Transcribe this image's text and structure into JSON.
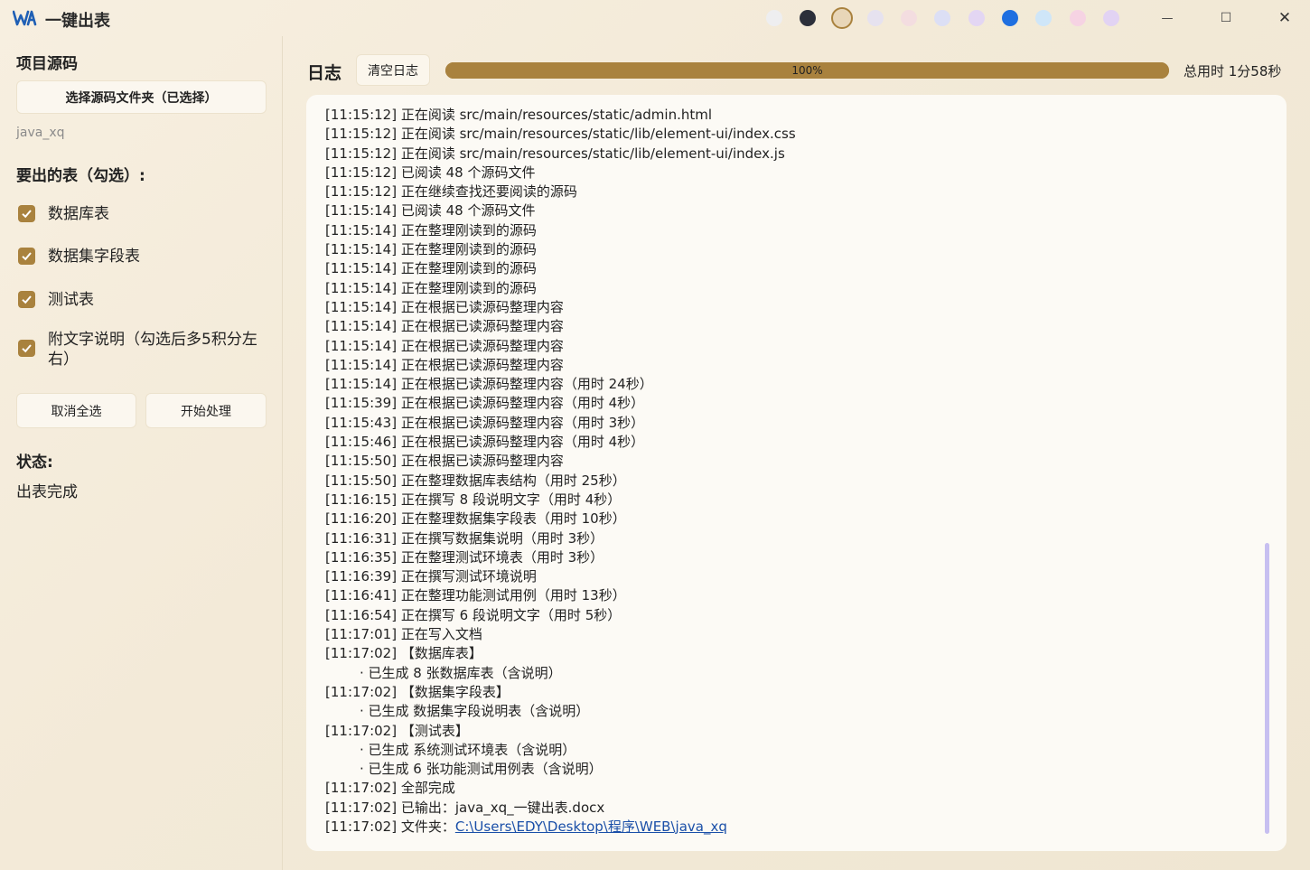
{
  "app": {
    "title": "一键出表",
    "window_controls": {
      "minimize": "—",
      "maximize": "☐",
      "close": "✕"
    }
  },
  "theme": {
    "accent": "#a9823e",
    "swatches": [
      {
        "name": "white",
        "color": "#eeeef0",
        "active": false
      },
      {
        "name": "dark",
        "color": "#2b2f3a",
        "active": false
      },
      {
        "name": "beige",
        "color": "#e8d6b8",
        "active": true
      },
      {
        "name": "lavender-grey",
        "color": "#e6e2ef",
        "active": false
      },
      {
        "name": "light-pink",
        "color": "#f3dde0",
        "active": false
      },
      {
        "name": "periwinkle",
        "color": "#dcdff5",
        "active": false
      },
      {
        "name": "lilac",
        "color": "#e3d6f3",
        "active": false
      },
      {
        "name": "blue",
        "color": "#1f6fe0",
        "active": false
      },
      {
        "name": "sky",
        "color": "#cfe6f8",
        "active": false
      },
      {
        "name": "pink",
        "color": "#f6d3e3",
        "active": false
      },
      {
        "name": "violet",
        "color": "#e2d3f3",
        "active": false
      }
    ]
  },
  "sidebar": {
    "source_title": "项目源码",
    "select_folder_label": "选择源码文件夹（已选择）",
    "folder_name": "java_xq",
    "tables_title": "要出的表（勾选）:",
    "options": [
      {
        "label": "数据库表",
        "checked": true
      },
      {
        "label": "数据集字段表",
        "checked": true
      },
      {
        "label": "测试表",
        "checked": true
      },
      {
        "label": "附文字说明（勾选后多5积分左右）",
        "checked": true
      }
    ],
    "deselect_all_label": "取消全选",
    "start_label": "开始处理",
    "status_title": "状态:",
    "status_value": "出表完成"
  },
  "main": {
    "log_title": "日志",
    "clear_log_label": "清空日志",
    "progress": {
      "value": 100,
      "label": "100%"
    },
    "total_time": "总用时 1分58秒",
    "log_lines": [
      {
        "text": "[11:15:12] 正在阅读 src/main/resources/static/admin.html"
      },
      {
        "text": "[11:15:12] 正在阅读 src/main/resources/static/lib/element-ui/index.css"
      },
      {
        "text": "[11:15:12] 正在阅读 src/main/resources/static/lib/element-ui/index.js"
      },
      {
        "text": "[11:15:12] 已阅读 48 个源码文件"
      },
      {
        "text": "[11:15:12] 正在继续查找还要阅读的源码"
      },
      {
        "text": "[11:15:14] 已阅读 48 个源码文件"
      },
      {
        "text": "[11:15:14] 正在整理刚读到的源码"
      },
      {
        "text": "[11:15:14] 正在整理刚读到的源码"
      },
      {
        "text": "[11:15:14] 正在整理刚读到的源码"
      },
      {
        "text": "[11:15:14] 正在整理刚读到的源码"
      },
      {
        "text": "[11:15:14] 正在根据已读源码整理内容"
      },
      {
        "text": "[11:15:14] 正在根据已读源码整理内容"
      },
      {
        "text": "[11:15:14] 正在根据已读源码整理内容"
      },
      {
        "text": "[11:15:14] 正在根据已读源码整理内容"
      },
      {
        "text": "[11:15:14] 正在根据已读源码整理内容（用时 24秒）"
      },
      {
        "text": "[11:15:39] 正在根据已读源码整理内容（用时 4秒）"
      },
      {
        "text": "[11:15:43] 正在根据已读源码整理内容（用时 3秒）"
      },
      {
        "text": "[11:15:46] 正在根据已读源码整理内容（用时 4秒）"
      },
      {
        "text": "[11:15:50] 正在根据已读源码整理内容"
      },
      {
        "text": "[11:15:50] 正在整理数据库表结构（用时 25秒）"
      },
      {
        "text": "[11:16:15] 正在撰写 8 段说明文字（用时 4秒）"
      },
      {
        "text": "[11:16:20] 正在整理数据集字段表（用时 10秒）"
      },
      {
        "text": "[11:16:31] 正在撰写数据集说明（用时 3秒）"
      },
      {
        "text": "[11:16:35] 正在整理测试环境表（用时 3秒）"
      },
      {
        "text": "[11:16:39] 正在撰写测试环境说明"
      },
      {
        "text": "[11:16:41] 正在整理功能测试用例（用时 13秒）"
      },
      {
        "text": "[11:16:54] 正在撰写 6 段说明文字（用时 5秒）"
      },
      {
        "text": "[11:17:01] 正在写入文档"
      },
      {
        "text": "[11:17:02] 【数据库表】"
      },
      {
        "text": "· 已生成 8 张数据库表（含说明）",
        "indent": true
      },
      {
        "text": "[11:17:02] 【数据集字段表】"
      },
      {
        "text": "· 已生成 数据集字段说明表（含说明）",
        "indent": true
      },
      {
        "text": "[11:17:02] 【测试表】"
      },
      {
        "text": "· 已生成 系统测试环境表（含说明）",
        "indent": true
      },
      {
        "text": "· 已生成 6 张功能测试用例表（含说明）",
        "indent": true
      },
      {
        "text": "[11:17:02] 全部完成"
      },
      {
        "text": "[11:17:02] 已输出：java_xq_一键出表.docx"
      },
      {
        "text": "[11:17:02] 文件夹：",
        "link": "C:\\Users\\EDY\\Desktop\\程序\\WEB\\java_xq"
      }
    ]
  }
}
